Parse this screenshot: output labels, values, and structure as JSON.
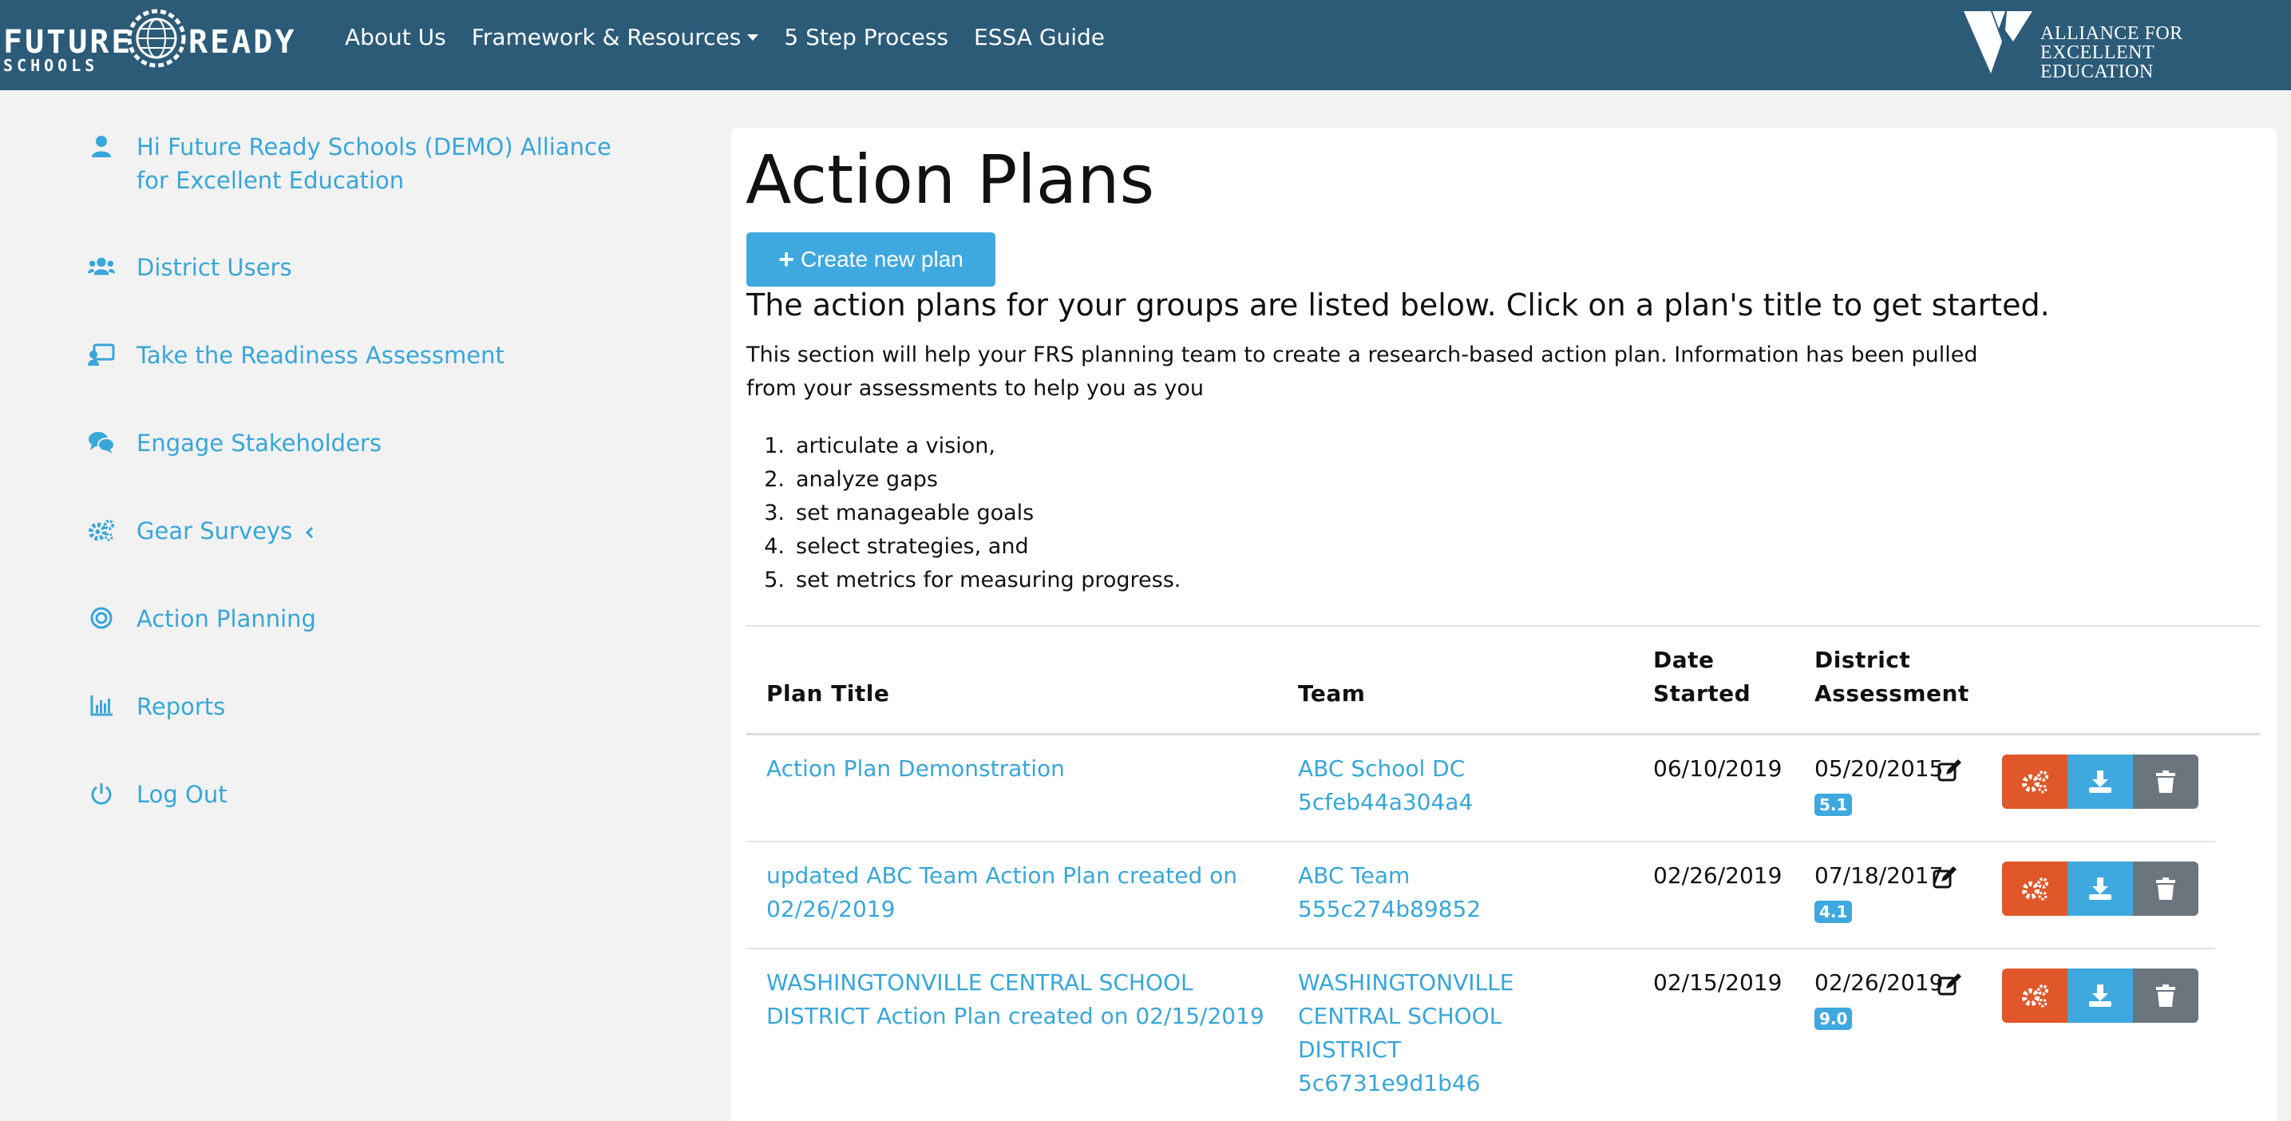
{
  "brand": {
    "logo_top_left": "FUTURE",
    "logo_top_right": "READY",
    "logo_bottom": "SCHOOLS",
    "alliance_line1": "ALLIANCE FOR",
    "alliance_line2": "EXCELLENT EDUCATION"
  },
  "nav": {
    "about": "About Us",
    "framework": "Framework & Resources",
    "five_step": "5 Step Process",
    "essa": "ESSA Guide"
  },
  "sidebar": {
    "greeting": "Hi Future Ready Schools (DEMO) Alliance for Excellent Education",
    "items": [
      {
        "label": "District Users",
        "icon": "users-icon"
      },
      {
        "label": "Take the Readiness Assessment",
        "icon": "chalkboard-teacher-icon"
      },
      {
        "label": "Engage Stakeholders",
        "icon": "comments-icon"
      },
      {
        "label": "Gear Surveys",
        "icon": "cogs-icon"
      },
      {
        "label": "Action Planning",
        "icon": "bullseye-icon"
      },
      {
        "label": "Reports",
        "icon": "chart-bar-icon"
      },
      {
        "label": "Log Out",
        "icon": "power-icon"
      }
    ]
  },
  "main": {
    "title": "Action Plans",
    "create_label": "Create new plan",
    "subtitle": "The action plans for your groups are listed below. Click on a plan's title to get started.",
    "intro_line1": "This section will help your FRS planning team to create a research-based action plan. Information has been pulled",
    "intro_line2": "from your assessments to help you as you",
    "steps": [
      "articulate a vision,",
      "analyze gaps",
      "set manageable goals",
      "select strategies, and",
      "set metrics for measuring progress."
    ]
  },
  "table": {
    "headers": {
      "plan_title": "Plan Title",
      "team": "Team",
      "date_line1": "Date",
      "date_line2": "Started",
      "district_line1": "District",
      "district_line2": "Assessment"
    },
    "rows": [
      {
        "plan_line1": "Action Plan Demonstration",
        "plan_line2": "",
        "team_lines": [
          "ABC School DC",
          "5cfeb44a304a4"
        ],
        "date_started": "06/10/2019",
        "assessment_date": "05/20/2015",
        "score": "5.1"
      },
      {
        "plan_line1": "updated ABC Team Action Plan created on",
        "plan_line2": "02/26/2019",
        "team_lines": [
          "ABC Team",
          "555c274b89852"
        ],
        "date_started": "02/26/2019",
        "assessment_date": "07/18/2017",
        "score": "4.1"
      },
      {
        "plan_line1": "WASHINGTONVILLE CENTRAL SCHOOL",
        "plan_line2": "DISTRICT Action Plan created on 02/15/2019",
        "team_lines": [
          "WASHINGTONVILLE",
          "CENTRAL SCHOOL",
          "DISTRICT",
          "5c6731e9d1b46"
        ],
        "date_started": "02/15/2019",
        "assessment_date": "02/26/2019",
        "score": "9.0"
      }
    ]
  },
  "colors": {
    "navbar": "#2c5b78",
    "link": "#38a6d8",
    "primary_button": "#3fa8de",
    "settings_button": "#e0572a",
    "delete_button": "#6c757d"
  }
}
